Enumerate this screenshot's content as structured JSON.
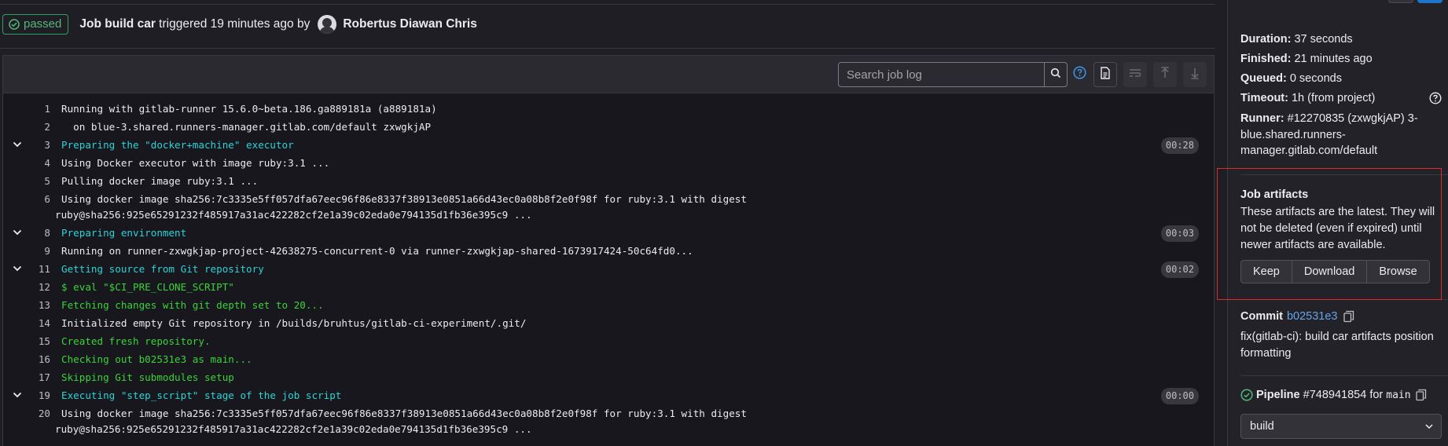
{
  "header": {
    "status": "passed",
    "job_prefix": "Job",
    "job_name": "build car",
    "triggered_text": "triggered 19 minutes ago by",
    "author": "Robertus Diawan Chris"
  },
  "log_toolbar": {
    "search_placeholder": "Search job log"
  },
  "log": [
    {
      "n": "1",
      "text": "Running with gitlab-runner 15.6.0~beta.186.ga889181a (a889181a)",
      "style": ""
    },
    {
      "n": "2",
      "text": "  on blue-3.shared.runners-manager.gitlab.com/default zxwgkjAP",
      "style": ""
    },
    {
      "n": "3",
      "text": "Preparing the \"docker+machine\" executor",
      "style": "section",
      "duration": "00:28"
    },
    {
      "n": "4",
      "text": "Using Docker executor with image ruby:3.1 ...",
      "style": ""
    },
    {
      "n": "5",
      "text": "Pulling docker image ruby:3.1 ...",
      "style": ""
    },
    {
      "n": "6",
      "text": "Using docker image sha256:7c3335e5ff057dfa67eec96f86e8337f38913e0851a66d43ec0a08b8f2e0f98f for ruby:3.1 with digest ruby@sha256:925e65291232f485917a31ac422282cf2e1a39c02eda0e794135d1fb36e395c9 ...",
      "style": "",
      "wrap": true
    },
    {
      "n": "8",
      "text": "Preparing environment",
      "style": "section",
      "duration": "00:03"
    },
    {
      "n": "9",
      "text": "Running on runner-zxwgkjap-project-42638275-concurrent-0 via runner-zxwgkjap-shared-1673917424-50c64fd0...",
      "style": ""
    },
    {
      "n": "11",
      "text": "Getting source from Git repository",
      "style": "section",
      "duration": "00:02"
    },
    {
      "n": "12",
      "text": "$ eval \"$CI_PRE_CLONE_SCRIPT\"",
      "style": "green"
    },
    {
      "n": "13",
      "text": "Fetching changes with git depth set to 20...",
      "style": "green"
    },
    {
      "n": "14",
      "text": "Initialized empty Git repository in /builds/bruhtus/gitlab-ci-experiment/.git/",
      "style": ""
    },
    {
      "n": "15",
      "text": "Created fresh repository.",
      "style": "green"
    },
    {
      "n": "16",
      "text": "Checking out b02531e3 as main...",
      "style": "green"
    },
    {
      "n": "17",
      "text": "Skipping Git submodules setup",
      "style": "green"
    },
    {
      "n": "19",
      "text": "Executing \"step_script\" stage of the job script",
      "style": "section",
      "duration": "00:00"
    },
    {
      "n": "20",
      "text": "Using docker image sha256:7c3335e5ff057dfa67eec96f86e8337f38913e0851a66d43ec0a08b8f2e0f98f for ruby:3.1 with digest ruby@sha256:925e65291232f485917a31ac422282cf2e1a39c02eda0e794135d1fb36e395c9 ...",
      "style": "",
      "wrap": true
    }
  ],
  "sidebar": {
    "duration_label": "Duration:",
    "duration": "37 seconds",
    "finished_label": "Finished:",
    "finished": "21 minutes ago",
    "queued_label": "Queued:",
    "queued": "0 seconds",
    "timeout_label": "Timeout:",
    "timeout": "1h (from project)",
    "runner_label": "Runner:",
    "runner": "#12270835 (zxwgkjAP) 3-blue.shared.runners-manager.gitlab.com/default",
    "artifacts_title": "Job artifacts",
    "artifacts_desc": "These artifacts are the latest. They will not be deleted (even if expired) until newer artifacts are available.",
    "keep_label": "Keep",
    "download_label": "Download",
    "browse_label": "Browse",
    "commit_label": "Commit",
    "commit_sha": "b02531e3",
    "commit_message": "fix(gitlab-ci): build car artifacts position formatting",
    "pipeline_label": "Pipeline",
    "pipeline_id": "#748941854",
    "pipeline_for": "for",
    "pipeline_ref": "main",
    "stage": "build"
  },
  "colors": {
    "success": "#2da160",
    "section_text": "#2bd3d6",
    "green_text": "#3ad33a",
    "link": "#63a6e9",
    "highlight_box": "#dd2b2b"
  }
}
